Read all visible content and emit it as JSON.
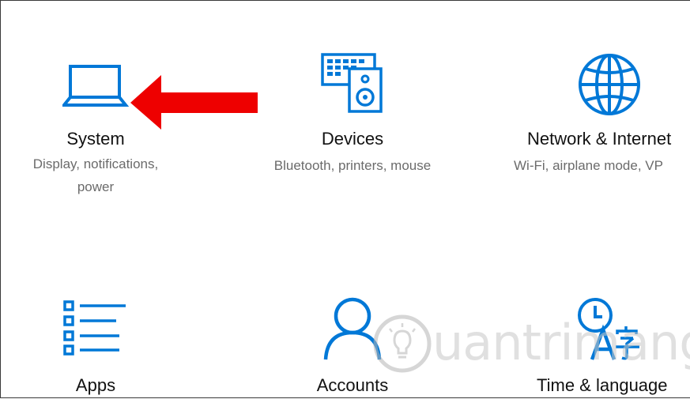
{
  "settings": {
    "tiles": [
      {
        "title": "System",
        "description_line1": "Display, notifications,",
        "description_line2": "power",
        "icon": "laptop-icon"
      },
      {
        "title": "Devices",
        "description_line1": "Bluetooth, printers, mouse",
        "icon": "keyboard-speaker-icon"
      },
      {
        "title": "Network & Internet",
        "description_line1": "Wi-Fi, airplane mode, VP",
        "icon": "globe-icon"
      },
      {
        "title": "Apps",
        "icon": "apps-list-icon"
      },
      {
        "title": "Accounts",
        "icon": "person-icon"
      },
      {
        "title": "Time & language",
        "icon": "clock-language-icon"
      }
    ]
  },
  "watermark": {
    "text": "uantrimang"
  },
  "colors": {
    "accent": "#0078d7",
    "arrow": "#ee0000",
    "title": "#111111",
    "description": "#6b6b6b"
  }
}
